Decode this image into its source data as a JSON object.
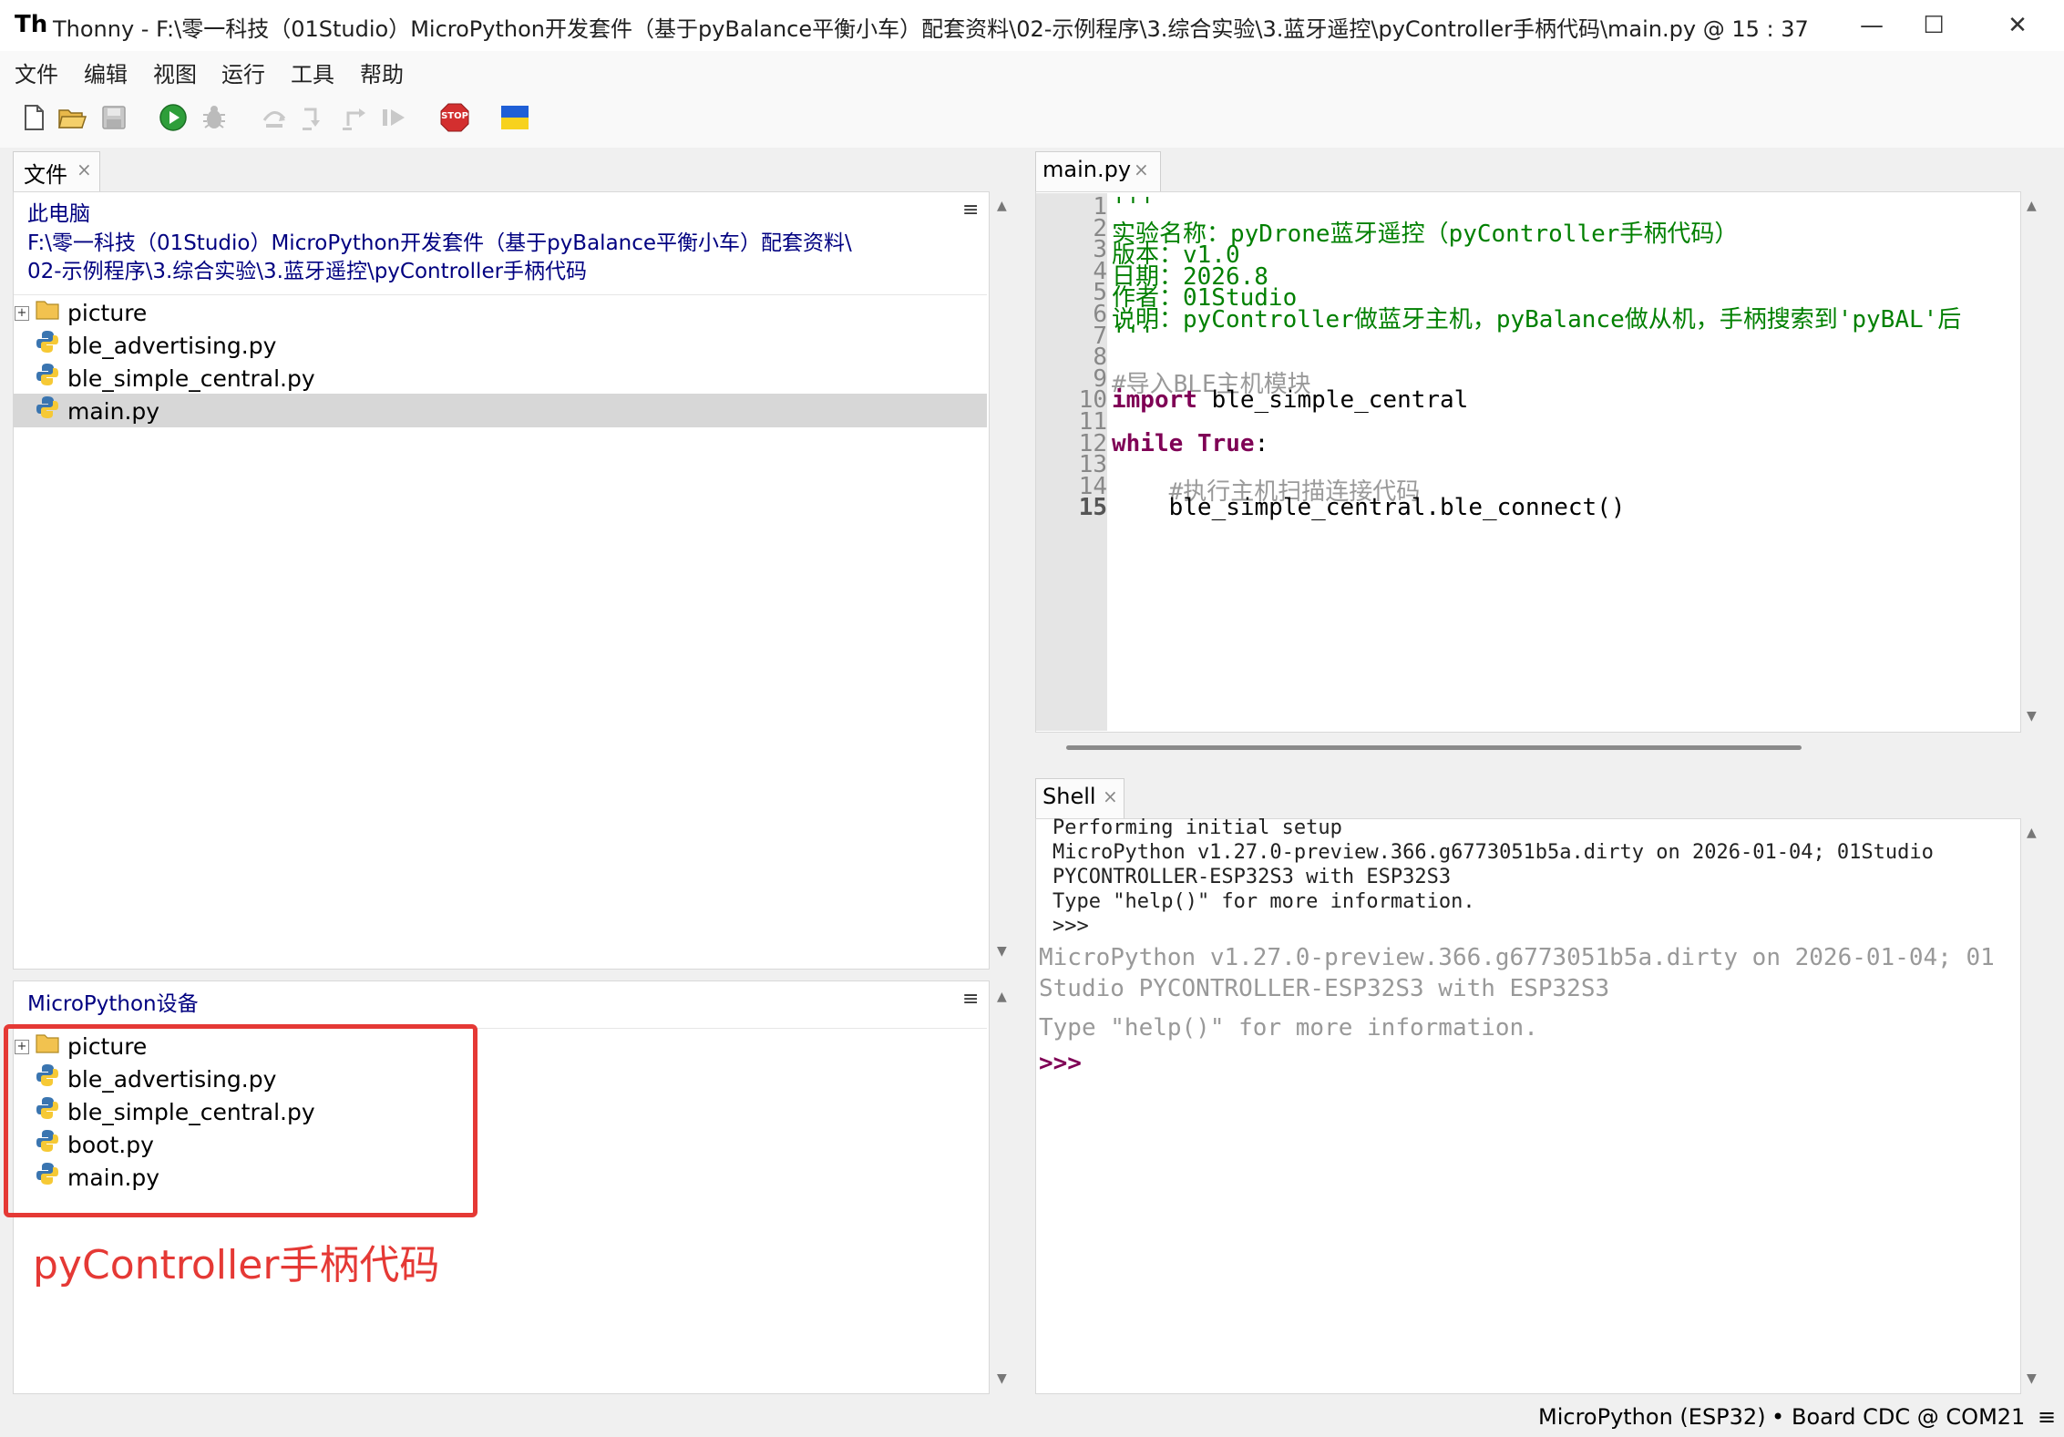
{
  "window": {
    "logo": "Th",
    "title": "Thonny  -  F:\\零一科技（01Studio）MicroPython开发套件（基于pyBalance平衡小车）配套资料\\02-示例程序\\3.综合实验\\3.蓝牙遥控\\pyController手柄代码\\main.py  @  15 : 37",
    "minimize": "—",
    "maximize": "☐",
    "close": "✕"
  },
  "menu": [
    "文件",
    "编辑",
    "视图",
    "运行",
    "工具",
    "帮助"
  ],
  "toolbar": {
    "icons": [
      "new-file-icon",
      "open-file-icon",
      "save-icon",
      "run-icon",
      "debug-icon",
      "step-over-icon",
      "step-into-icon",
      "step-out-icon",
      "resume-icon",
      "stop-icon",
      "ukraine-flag-icon"
    ],
    "stop_label": "STOP"
  },
  "files_panel": {
    "tab_label": "文件",
    "tab_close": "×",
    "computer": {
      "header_title": "此电脑",
      "path_line1": "F:\\零一科技（01Studio）MicroPython开发套件（基于pyBalance平衡小车）配套资料\\",
      "path_line2": "02-示例程序\\3.综合实验\\3.蓝牙遥控\\pyController手柄代码",
      "menu_icon": "≡",
      "items": [
        {
          "name": "picture",
          "type": "folder"
        },
        {
          "name": "ble_advertising.py",
          "type": "python"
        },
        {
          "name": "ble_simple_central.py",
          "type": "python"
        },
        {
          "name": "main.py",
          "type": "python",
          "selected": true
        }
      ]
    },
    "device": {
      "header_title": "MicroPython设备",
      "menu_icon": "≡",
      "items": [
        {
          "name": "picture",
          "type": "folder"
        },
        {
          "name": "ble_advertising.py",
          "type": "python"
        },
        {
          "name": "ble_simple_central.py",
          "type": "python"
        },
        {
          "name": "boot.py",
          "type": "python"
        },
        {
          "name": "main.py",
          "type": "python"
        }
      ],
      "annotation": "pyController手柄代码",
      "annotation_color": "#e53935"
    }
  },
  "editor": {
    "tab_label": "main.py",
    "tab_close": "×",
    "line_numbers": [
      "1",
      "2",
      "3",
      "4",
      "5",
      "6",
      "7",
      "8",
      "9",
      "10",
      "11",
      "12",
      "13",
      "14",
      "15"
    ],
    "lines": [
      {
        "t": "'''",
        "c": "str"
      },
      {
        "t": "实验名称：pyDrone蓝牙遥控（pyController手柄代码）",
        "c": "str"
      },
      {
        "t": "版本：v1.0",
        "c": "str"
      },
      {
        "t": "日期：2026.8",
        "c": "str"
      },
      {
        "t": "作者：01Studio",
        "c": "str"
      },
      {
        "t": "说明：pyController做蓝牙主机，pyBalance做从机，手柄搜索到'pyBAL'后",
        "c": "str"
      },
      {
        "t": "'''",
        "c": "str"
      },
      {
        "t": "",
        "c": "plain"
      },
      {
        "t": "#导入BLE主机模块",
        "c": "com"
      },
      {
        "parts": [
          {
            "t": "import",
            "c": "kw"
          },
          {
            "t": " ble_simple_central",
            "c": "plain"
          }
        ]
      },
      {
        "t": "",
        "c": "plain"
      },
      {
        "parts": [
          {
            "t": "while",
            "c": "kw"
          },
          {
            "t": " ",
            "c": "plain"
          },
          {
            "t": "True",
            "c": "kw"
          },
          {
            "t": ":",
            "c": "plain"
          }
        ]
      },
      {
        "t": "",
        "c": "plain"
      },
      {
        "t": "    #执行主机扫描连接代码",
        "c": "com"
      },
      {
        "t": "    ble_simple_central.ble_connect()",
        "c": "plain"
      }
    ]
  },
  "shell": {
    "tab_label": "Shell",
    "tab_close": "×",
    "history": [
      "Performing initial setup",
      "MicroPython v1.27.0-preview.366.g6773051b5a.dirty on 2026-01-04; 01Studio",
      "PYCONTROLLER-ESP32S3 with ESP32S3",
      "Type \"help()\" for more information.",
      ">>>"
    ],
    "output": [
      "MicroPython v1.27.0-preview.366.g6773051b5a.dirty on 2026-01-04; 01",
      "Studio PYCONTROLLER-ESP32S3 with ESP32S3",
      "Type \"help()\" for more information."
    ],
    "prompt": ">>>"
  },
  "status": {
    "interpreter": "MicroPython (ESP32)",
    "separator": "•",
    "port": "Board CDC @ COM21",
    "menu_icon": "≡"
  }
}
